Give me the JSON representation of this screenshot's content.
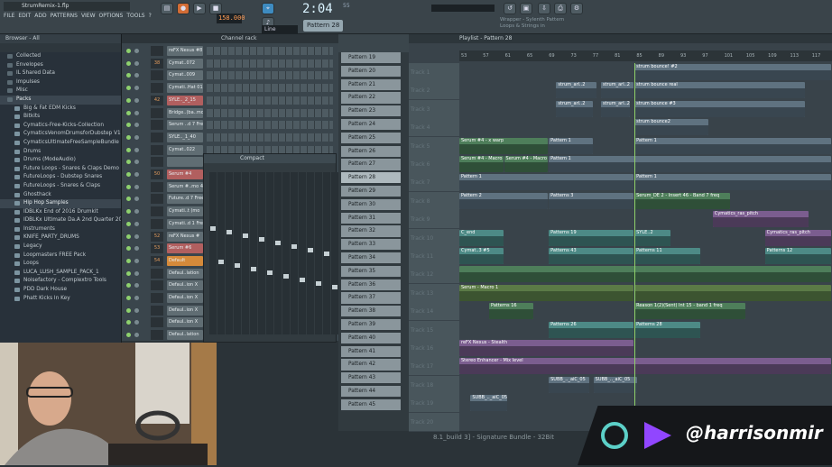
{
  "window": {
    "title": "StrumRemix-1.flp"
  },
  "menu": [
    "FILE",
    "EDIT",
    "ADD",
    "PATTERNS",
    "VIEW",
    "OPTIONS",
    "TOOLS",
    "?"
  ],
  "transport": {
    "time": "2:04",
    "time_sub": "55",
    "tempo": "158.000",
    "pattern": "Pattern 28",
    "mode": "Line"
  },
  "hint": {
    "line1": "Wrapper - Sylenth Pattern",
    "line2": "Loops & Strings in"
  },
  "browser": {
    "title": "Browser - All",
    "items": [
      {
        "label": "Collected",
        "sub": false
      },
      {
        "label": "Envelopes",
        "sub": false
      },
      {
        "label": "IL Shared Data",
        "sub": false
      },
      {
        "label": "Impulses",
        "sub": false
      },
      {
        "label": "Misc",
        "sub": false
      },
      {
        "label": "Packs",
        "sub": false,
        "hl": true
      },
      {
        "label": "Big & Fat EDM Kicks",
        "sub": true
      },
      {
        "label": "Bitkits",
        "sub": true
      },
      {
        "label": "Cymatics-Free-Kicks-Collection",
        "sub": true
      },
      {
        "label": "CymaticsVenomDrumsforDubstep V1 Kfg",
        "sub": true
      },
      {
        "label": "CymaticsUltimateFreeSampleBundle",
        "sub": true
      },
      {
        "label": "Drums",
        "sub": true
      },
      {
        "label": "Drums (ModeAudio)",
        "sub": true
      },
      {
        "label": "Future Loops - Snares & Claps Demo",
        "sub": true
      },
      {
        "label": "FutureLoops - Dubstep Snares",
        "sub": true
      },
      {
        "label": "FutureLoops - Snares & Claps",
        "sub": true
      },
      {
        "label": "Ghosthack",
        "sub": true
      },
      {
        "label": "Hip Hop Samples",
        "sub": true,
        "hl": true
      },
      {
        "label": "IDBLKx End of 2016 Drumkit",
        "sub": true
      },
      {
        "label": "IDBLKx Ultimate Da.A 2nd Quarter 2016",
        "sub": true
      },
      {
        "label": "Instruments",
        "sub": true
      },
      {
        "label": "KNIFE_PARTY_DRUMS",
        "sub": true
      },
      {
        "label": "Legacy",
        "sub": true
      },
      {
        "label": "Loopmasters FREE Pack",
        "sub": true
      },
      {
        "label": "Loops",
        "sub": true
      },
      {
        "label": "LUCA_LUSH_SAMPLE_PACK_1",
        "sub": true
      },
      {
        "label": "Noisefactory - Complextro Tools",
        "sub": true
      },
      {
        "label": "PDD Dark House",
        "sub": true
      },
      {
        "label": "Phatt Kicks In Key",
        "sub": true
      }
    ]
  },
  "rack": {
    "title": "Channel rack",
    "channels": [
      {
        "num": "",
        "name": "reFX Nexus #8",
        "color": "grey"
      },
      {
        "num": "38",
        "name": "Cymat..072",
        "color": "grey"
      },
      {
        "num": "",
        "name": "Cymat..009",
        "color": "grey"
      },
      {
        "num": "",
        "name": "Cymati..Hat 012",
        "color": "grey"
      },
      {
        "num": "42",
        "name": "SYLE.._2_15",
        "color": "red"
      },
      {
        "num": "",
        "name": "Bridge..(ba..mono)",
        "color": "grey"
      },
      {
        "num": "",
        "name": "Serum ..d 7 Free",
        "color": "grey"
      },
      {
        "num": "",
        "name": "SYLE.._1_40",
        "color": "grey"
      },
      {
        "num": "",
        "name": "Cymat..022",
        "color": "grey"
      },
      {
        "num": "",
        "name": "",
        "color": "grey"
      },
      {
        "num": "50",
        "name": "Serum #4",
        "color": "red"
      },
      {
        "num": "",
        "name": "Serum #..mo 4",
        "color": "grey"
      },
      {
        "num": "",
        "name": "Future..d 7 Free",
        "color": "grey"
      },
      {
        "num": "",
        "name": "Cymati..t (mo",
        "color": "grey"
      },
      {
        "num": "",
        "name": "Cymati..d 1 Free",
        "color": "grey"
      },
      {
        "num": "52",
        "name": "reFX Nexus #",
        "color": "grey"
      },
      {
        "num": "53",
        "name": "Serum #6",
        "color": "red"
      },
      {
        "num": "54",
        "name": "Default",
        "color": "orange"
      },
      {
        "num": "",
        "name": "Defaul..lation",
        "color": "grey"
      },
      {
        "num": "",
        "name": "Defaul..ion X",
        "color": "grey"
      },
      {
        "num": "",
        "name": "Defaul..ion X",
        "color": "grey"
      },
      {
        "num": "",
        "name": "Defaul..ion X",
        "color": "grey"
      },
      {
        "num": "",
        "name": "Defaul..ion X",
        "color": "grey"
      },
      {
        "num": "",
        "name": "Defaul..lation",
        "color": "grey"
      }
    ]
  },
  "mixer": {
    "title": "Compact"
  },
  "patterns": [
    "Pattern 19",
    "Pattern 20",
    "Pattern 21",
    "Pattern 22",
    "Pattern 23",
    "Pattern 24",
    "Pattern 25",
    "Pattern 26",
    "Pattern 27",
    "Pattern 28",
    "Pattern 29",
    "Pattern 30",
    "Pattern 31",
    "Pattern 32",
    "Pattern 33",
    "Pattern 34",
    "Pattern 35",
    "Pattern 36",
    "Pattern 37",
    "Pattern 38",
    "Pattern 39",
    "Pattern 40",
    "Pattern 41",
    "Pattern 42",
    "Pattern 43",
    "Pattern 44",
    "Pattern 45"
  ],
  "selected_pattern_index": 9,
  "playlist": {
    "title": "Playlist - Pattern 28",
    "ruler": [
      "53",
      "57",
      "61",
      "65",
      "69",
      "73",
      "77",
      "81",
      "85",
      "89",
      "93",
      "97",
      "101",
      "105",
      "109",
      "113",
      "117"
    ],
    "tracks": [
      {
        "label": "Track 1",
        "clips": [
          {
            "text": "strum bounce! #2",
            "l": 0.47,
            "w": 0.53,
            "c": "cs"
          }
        ]
      },
      {
        "label": "Track 2",
        "clips": [
          {
            "text": "strum_arl..2",
            "l": 0.26,
            "w": 0.11,
            "c": "cs"
          },
          {
            "text": "strum_arl..2",
            "l": 0.38,
            "w": 0.09,
            "c": "cs"
          },
          {
            "text": "strum bounce real",
            "l": 0.47,
            "w": 0.46,
            "c": "cs"
          }
        ]
      },
      {
        "label": "Track 3",
        "clips": [
          {
            "text": "strum_arl..2",
            "l": 0.26,
            "w": 0.1,
            "c": "cs"
          },
          {
            "text": "strum_arl..2",
            "l": 0.38,
            "w": 0.08,
            "c": "cs"
          },
          {
            "text": "strum bounce #3",
            "l": 0.47,
            "w": 0.46,
            "c": "cs"
          }
        ]
      },
      {
        "label": "Track 4",
        "clips": [
          {
            "text": "strum bounce2",
            "l": 0.47,
            "w": 0.2,
            "c": "cs"
          }
        ]
      },
      {
        "label": "Track 5",
        "clips": [
          {
            "text": "Serum #4 - x warp",
            "l": 0,
            "w": 0.24,
            "c": "cg"
          },
          {
            "text": "Pattern 1",
            "l": 0.24,
            "w": 0.12,
            "c": "cs"
          },
          {
            "text": "Pattern 1",
            "l": 0.47,
            "w": 0.53,
            "c": "cs"
          }
        ]
      },
      {
        "label": "Track 6",
        "clips": [
          {
            "text": "Serum #4 - Macro 1",
            "l": 0,
            "w": 0.12,
            "c": "cg"
          },
          {
            "text": "Serum #4 - Macro 1",
            "l": 0.12,
            "w": 0.12,
            "c": "cg"
          },
          {
            "text": "Pattern 1",
            "l": 0.24,
            "w": 0.76,
            "c": "cs"
          }
        ]
      },
      {
        "label": "Track 7",
        "clips": [
          {
            "text": "Pattern 1",
            "l": 0,
            "w": 0.47,
            "c": "cs"
          },
          {
            "text": "Pattern 1",
            "l": 0.47,
            "w": 0.53,
            "c": "cs"
          }
        ]
      },
      {
        "label": "Track 8",
        "clips": [
          {
            "text": "Pattern 2",
            "l": 0,
            "w": 0.24,
            "c": "cs"
          },
          {
            "text": "Patterns 3",
            "l": 0.24,
            "w": 0.23,
            "c": "cs"
          },
          {
            "text": "Serum_DE 2 - Insert 46 - Band 7 freq",
            "l": 0.47,
            "w": 0.26,
            "c": "cg"
          }
        ]
      },
      {
        "label": "Track 9",
        "clips": [
          {
            "text": "Cymatics_ras_pitch",
            "l": 0.68,
            "w": 0.26,
            "c": "cp"
          }
        ]
      },
      {
        "label": "Track 10",
        "clips": [
          {
            "text": "C_end",
            "l": 0,
            "w": 0.12,
            "c": "ct"
          },
          {
            "text": "Patterns 19",
            "l": 0.24,
            "w": 0.23,
            "c": "ct"
          },
          {
            "text": "SYLE..2",
            "l": 0.47,
            "w": 0.1,
            "c": "ct"
          },
          {
            "text": "Cymatics_ras_pitch",
            "l": 0.82,
            "w": 0.18,
            "c": "cp"
          }
        ]
      },
      {
        "label": "Track 11",
        "clips": [
          {
            "text": "Cymat..3 #5",
            "l": 0,
            "w": 0.12,
            "c": "ct"
          },
          {
            "text": "Patterns 43",
            "l": 0.24,
            "w": 0.23,
            "c": "ct"
          },
          {
            "text": "Patterns 11",
            "l": 0.47,
            "w": 0.18,
            "c": "ct"
          },
          {
            "text": "Patterns 12",
            "l": 0.82,
            "w": 0.18,
            "c": "ct"
          }
        ]
      },
      {
        "label": "Track 12",
        "clips": [
          {
            "text": "",
            "l": 0,
            "w": 1.0,
            "c": "cg"
          }
        ]
      },
      {
        "label": "Track 13",
        "clips": [
          {
            "text": "Serum - Macro 1",
            "l": 0,
            "w": 0.47,
            "c": "cf"
          },
          {
            "text": "",
            "l": 0.47,
            "w": 0.53,
            "c": "cf"
          }
        ]
      },
      {
        "label": "Track 14",
        "clips": [
          {
            "text": "Patterns 16",
            "l": 0.08,
            "w": 0.12,
            "c": "cg"
          },
          {
            "text": "Reason 1(2)(Sent) Int 15 - band 1 freq",
            "l": 0.47,
            "w": 0.3,
            "c": "cg"
          }
        ]
      },
      {
        "label": "Track 15",
        "clips": [
          {
            "text": "Patterns 26",
            "l": 0.24,
            "w": 0.23,
            "c": "ct"
          },
          {
            "text": "Patterns 28",
            "l": 0.47,
            "w": 0.18,
            "c": "ct"
          }
        ]
      },
      {
        "label": "Track 16",
        "clips": [
          {
            "text": "reFX Nexus - Stealth",
            "l": 0,
            "w": 0.47,
            "c": "cp"
          }
        ]
      },
      {
        "label": "Track 17",
        "clips": [
          {
            "text": "Stereo Enhancer - Mix level",
            "l": 0,
            "w": 1.0,
            "c": "cp"
          }
        ]
      },
      {
        "label": "Track 18",
        "clips": [
          {
            "text": "SUBB_.._aiC_05",
            "l": 0.24,
            "w": 0.11,
            "c": "cs"
          },
          {
            "text": "SUBB_.._aiC_05",
            "l": 0.36,
            "w": 0.12,
            "c": "cs"
          }
        ]
      },
      {
        "label": "Track 19",
        "clips": [
          {
            "text": "SUBB_.._aiC_05",
            "l": 0.03,
            "w": 0.1,
            "c": "cs"
          }
        ]
      },
      {
        "label": "Track 20",
        "clips": [
          {
            "text": "",
            "l": 0.0,
            "w": 0.0,
            "c": "cs"
          }
        ]
      }
    ]
  },
  "status": {
    "text": "8.1_build 3] - Signature Bundle - 32Bit"
  },
  "brand": {
    "handle": "@harrisonmir"
  }
}
